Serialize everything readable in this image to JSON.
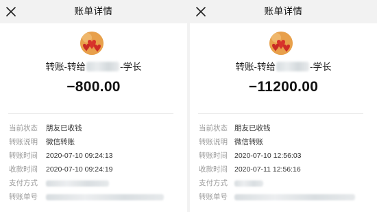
{
  "left": {
    "title": "账单详情",
    "payee_prefix": "转账-转给",
    "payee_suffix": "-学长",
    "amount": "−800.00",
    "details": [
      {
        "label": "当前状态",
        "value": "朋友已收钱"
      },
      {
        "label": "转账说明",
        "value": "微信转账"
      },
      {
        "label": "转账时间",
        "value": "2020-07-10 09:24:13"
      },
      {
        "label": "收款时间",
        "value": "2020-07-10 09:24:19"
      },
      {
        "label": "支付方式",
        "value": ""
      },
      {
        "label": "转账单号",
        "value": ""
      }
    ]
  },
  "right": {
    "title": "账单详情",
    "payee_prefix": "转账-转给",
    "payee_suffix": "-学长",
    "amount": "−11200.00",
    "details": [
      {
        "label": "当前状态",
        "value": "朋友已收钱"
      },
      {
        "label": "转账说明",
        "value": "微信转账"
      },
      {
        "label": "转账时间",
        "value": "2020-07-10 12:56:03"
      },
      {
        "label": "收款时间",
        "value": "2020-07-11 12:56:16"
      },
      {
        "label": "支付方式",
        "value": ""
      },
      {
        "label": "转账单号",
        "value": ""
      }
    ]
  },
  "icons": {
    "close": "close-icon",
    "avatar": "avatar-hearts-icon"
  },
  "colors": {
    "topbar_bg": "#f2f2f2",
    "label_gray": "#9a9a9a",
    "avatar_orange": "#e7a14a",
    "heart_red": "#d8332b"
  }
}
